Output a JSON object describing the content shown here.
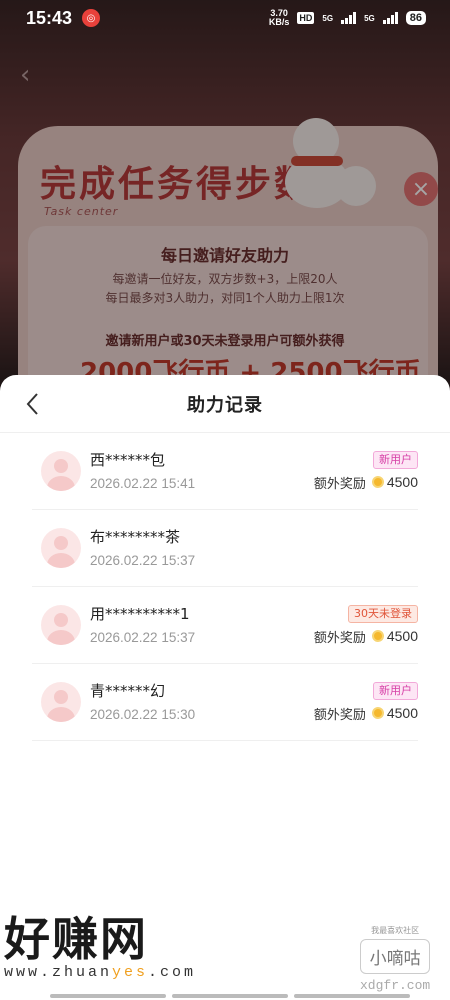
{
  "status_bar": {
    "time": "15:43",
    "net_speed_value": "3.70",
    "net_speed_unit": "KB/s",
    "hd": "HD",
    "signal1_label": "5G",
    "signal2_label": "5G",
    "battery": "86"
  },
  "background": {
    "promo_title": "完成任务得步数",
    "promo_subtitle": "Task center",
    "invite_title": "每日邀请好友助力",
    "invite_desc1": "每邀请一位好友，双方步数+3，上限20人",
    "invite_desc2": "每日最多对3人助力，对同1个人助力上限1次",
    "invite_bonus": "邀请新用户或30天未登录用户可额外获得",
    "invite_big": "2000飞行币 + 2500飞行币"
  },
  "sheet": {
    "title": "助力记录",
    "records": [
      {
        "name": "西******包",
        "time": "2026.02.22 15:41",
        "tag": "新用户",
        "tag_type": "new",
        "reward_label": "额外奖励",
        "reward": "4500"
      },
      {
        "name": "布********茶",
        "time": "2026.02.22 15:37"
      },
      {
        "name": "用**********1",
        "time": "2026.02.22 15:37",
        "tag": "30天未登录",
        "tag_type": "30",
        "reward_label": "额外奖励",
        "reward": "4500"
      },
      {
        "name": "青******幻",
        "time": "2026.02.22 15:30",
        "tag": "新用户",
        "tag_type": "new",
        "reward_label": "额外奖励",
        "reward": "4500"
      }
    ]
  },
  "watermark": {
    "left_big": "好赚网",
    "url_prefix": "www.zhuan",
    "url_highlight": "yes",
    "url_suffix": ".com",
    "right_top": "我最喜欢社区",
    "right_box": "小嘀咕",
    "right_url": "xdgfr.com"
  },
  "colors": {
    "tag_new": "#d63fa6",
    "tag_30": "#e0553a",
    "coin": "#f5b82e"
  }
}
